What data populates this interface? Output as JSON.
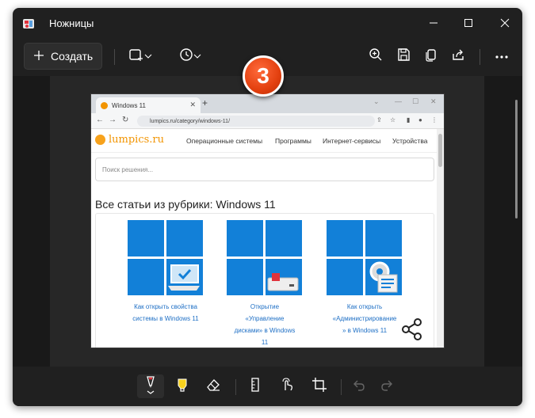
{
  "app": {
    "title": "Ножницы"
  },
  "toolbar": {
    "create_label": "Создать"
  },
  "annotation": {
    "step_number": "3"
  },
  "capture": {
    "browser": {
      "tab_title": "Windows 11",
      "new_tab": "+",
      "url": "lumpics.ru/category/windows-11/"
    },
    "site": {
      "logo": "lumpics.ru",
      "nav": [
        "Операционные системы",
        "Программы",
        "Интернет-сервисы",
        "Устройства"
      ],
      "search_placeholder": "Поиск решения...",
      "section_title": "Все статьи из рубрики: Windows 11",
      "cards": [
        {
          "lines": [
            "Как открыть свойства",
            "системы в Windows 11"
          ]
        },
        {
          "lines": [
            "Открытие",
            "«Управление",
            "дисками» в Windows",
            "11"
          ]
        },
        {
          "lines": [
            "Как открыть",
            "«Администрирование",
            "» в Windows 11"
          ]
        }
      ]
    }
  },
  "colors": {
    "window_bg": "#202020",
    "badge": "#e3400f",
    "pen_accent": "#e0323c",
    "highlighter": "#f7d21e",
    "tile_blue": "#1280d8",
    "link": "#1e6fc5",
    "logo": "#f29400"
  }
}
